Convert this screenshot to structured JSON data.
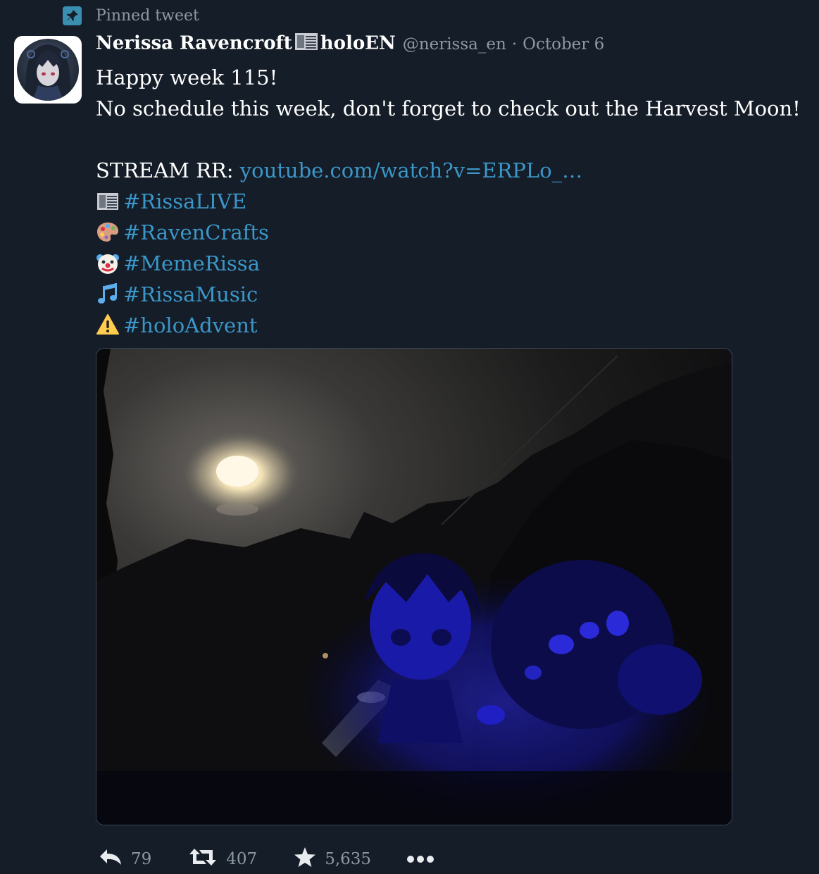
{
  "pinned": {
    "label": "Pinned tweet",
    "icon": "pin-icon"
  },
  "author": {
    "display_name_part1": "Nerissa Ravencroft",
    "display_name_part2": "holoEN",
    "name_emoji": "sheet-music-emoji",
    "handle": "@nerissa_en",
    "separator": "·",
    "date": "October 6"
  },
  "tweet": {
    "line1": "Happy week 115!",
    "line2": "No schedule this week, don't forget to check out the Harvest Moon!",
    "stream_prefix": "STREAM RR: ",
    "stream_link": "youtube.com/watch?v=ERPLo_…",
    "hashtags": [
      {
        "emoji": "sheet-music-emoji",
        "tag": "#RissaLIVE"
      },
      {
        "emoji": "palette-emoji",
        "tag": "#RavenCrafts"
      },
      {
        "emoji": "clown-face-emoji",
        "tag": "#MemeRissa"
      },
      {
        "emoji": "musical-notes-emoji",
        "tag": "#RissaMusic"
      },
      {
        "emoji": "warning-emoji",
        "tag": "#holoAdvent"
      }
    ]
  },
  "media": {
    "description_icon": "photo-attachment"
  },
  "actions": {
    "reply_count": "79",
    "retweet_count": "407",
    "like_count": "5,635",
    "more_label": "•••"
  },
  "colors": {
    "background": "#151d28",
    "link": "#3b97c9",
    "muted": "#8e99a6",
    "pin_badge": "#3a8fb0"
  }
}
